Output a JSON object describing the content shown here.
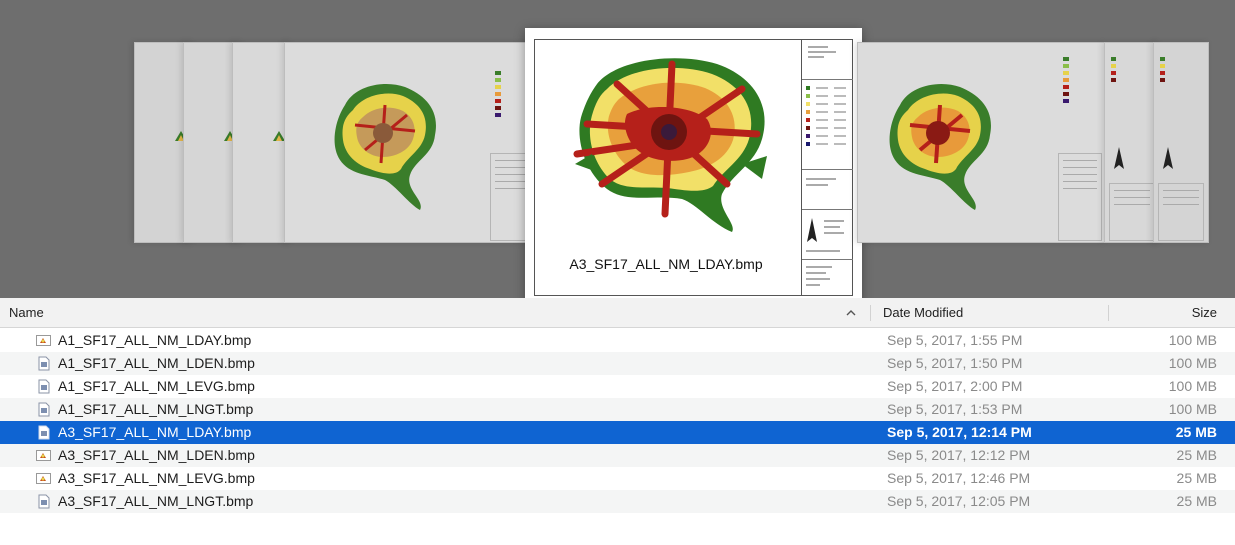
{
  "coverflow": {
    "selected_caption": "A3_SF17_ALL_NM_LDAY.bmp"
  },
  "columns": {
    "name": "Name",
    "date": "Date Modified",
    "size": "Size",
    "sort_indicator": "^"
  },
  "files": [
    {
      "name": "A1_SF17_ALL_NM_LDAY.bmp",
      "date": "Sep 5, 2017, 1:55 PM",
      "size": "100 MB",
      "icon": "bmp-preview-icon",
      "selected": false
    },
    {
      "name": "A1_SF17_ALL_NM_LDEN.bmp",
      "date": "Sep 5, 2017, 1:50 PM",
      "size": "100 MB",
      "icon": "bmp-document-icon",
      "selected": false
    },
    {
      "name": "A1_SF17_ALL_NM_LEVG.bmp",
      "date": "Sep 5, 2017, 2:00 PM",
      "size": "100 MB",
      "icon": "bmp-document-icon",
      "selected": false
    },
    {
      "name": "A1_SF17_ALL_NM_LNGT.bmp",
      "date": "Sep 5, 2017, 1:53 PM",
      "size": "100 MB",
      "icon": "bmp-document-icon",
      "selected": false
    },
    {
      "name": "A3_SF17_ALL_NM_LDAY.bmp",
      "date": "Sep 5, 2017, 12:14 PM",
      "size": "25 MB",
      "icon": "bmp-document-icon",
      "selected": true
    },
    {
      "name": "A3_SF17_ALL_NM_LDEN.bmp",
      "date": "Sep 5, 2017, 12:12 PM",
      "size": "25 MB",
      "icon": "bmp-preview-icon",
      "selected": false
    },
    {
      "name": "A3_SF17_ALL_NM_LEVG.bmp",
      "date": "Sep 5, 2017, 12:46 PM",
      "size": "25 MB",
      "icon": "bmp-preview-icon",
      "selected": false
    },
    {
      "name": "A3_SF17_ALL_NM_LNGT.bmp",
      "date": "Sep 5, 2017, 12:05 PM",
      "size": "25 MB",
      "icon": "bmp-document-icon",
      "selected": false
    }
  ],
  "colors": {
    "selection": "#0f64d2",
    "coverflow_bg": "#6e6e6e",
    "map_green": "#3a7d2a",
    "map_yellow": "#e6d24a",
    "map_red": "#b5201a",
    "map_darkred": "#6e1410"
  }
}
